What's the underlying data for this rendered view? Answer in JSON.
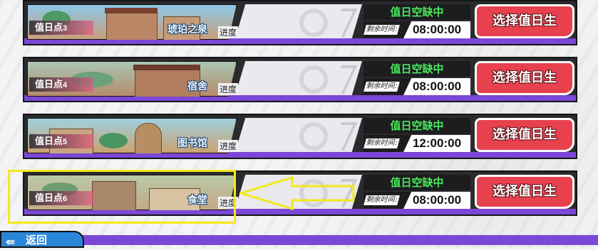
{
  "duty_points": [
    {
      "label": "值日点",
      "num": "3",
      "place": "琥珀之泉",
      "status": "值日空缺中",
      "remain_label": "剩余时间:",
      "time": "08:00:00",
      "button": "选择值日生",
      "progress_label": "进度",
      "scene_colors": [
        "#8cc8e8",
        "#c9a07a"
      ]
    },
    {
      "label": "值日点",
      "num": "4",
      "place": "宿舍",
      "status": "值日空缺中",
      "remain_label": "剩余时间:",
      "time": "08:00:00",
      "button": "选择值日生",
      "progress_label": "进度",
      "scene_colors": [
        "#a9c7b4",
        "#b58a6a"
      ]
    },
    {
      "label": "值日点",
      "num": "5",
      "place": "图书馆",
      "status": "值日空缺中",
      "remain_label": "剩余时间:",
      "time": "12:00:00",
      "button": "选择值日生",
      "progress_label": "进度",
      "scene_colors": [
        "#9fd0e0",
        "#caa36e"
      ]
    },
    {
      "label": "值日点",
      "num": "6",
      "place": "食堂",
      "status": "值日空缺中",
      "remain_label": "剩余时间:",
      "time": "08:00:00",
      "button": "选择值日生",
      "progress_label": "进度",
      "scene_colors": [
        "#b7c9a8",
        "#c6a987"
      ]
    }
  ],
  "back": {
    "label": "返回",
    "icon": "back-arrow-icon"
  },
  "colors": {
    "accent_purple": "#7b47d6",
    "status_green": "#49e95b",
    "button_red": "#e8414e",
    "highlight_yellow": "#f4e81c"
  }
}
